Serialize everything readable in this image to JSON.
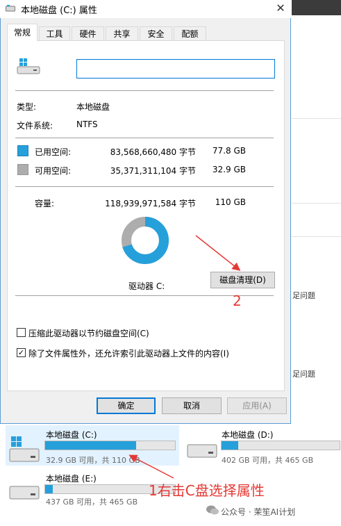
{
  "window": {
    "title": "本地磁盘 (C:) 属性",
    "close_glyph": "✕"
  },
  "tabs": [
    {
      "label": "常规",
      "active": true
    },
    {
      "label": "工具",
      "active": false
    },
    {
      "label": "硬件",
      "active": false
    },
    {
      "label": "共享",
      "active": false
    },
    {
      "label": "安全",
      "active": false
    },
    {
      "label": "配额",
      "active": false
    }
  ],
  "general": {
    "name_value": "",
    "type_label": "类型:",
    "type_value": "本地磁盘",
    "fs_label": "文件系统:",
    "fs_value": "NTFS",
    "used_label": "已用空间:",
    "used_bytes": "83,568,660,480 字节",
    "used_size": "77.8 GB",
    "free_label": "可用空间:",
    "free_bytes": "35,371,311,104 字节",
    "free_size": "32.9 GB",
    "capacity_label": "容量:",
    "capacity_bytes": "118,939,971,584 字节",
    "capacity_size": "110 GB",
    "drive_label": "驱动器 C:",
    "cleanup_button": "磁盘清理(D)",
    "used_fraction": 0.703,
    "compress_label": "压缩此驱动器以节约磁盘空间(C)",
    "compress_checked": false,
    "index_label": "除了文件属性外，还允许索引此驱动器上文件的内容(I)",
    "index_checked": true
  },
  "footer": {
    "ok": "确定",
    "cancel": "取消",
    "apply": "应用(A)"
  },
  "colors": {
    "used": "#26a0da",
    "free": "#adadad",
    "accent": "#0078d7",
    "annotation": "#e53935"
  },
  "background": {
    "snippet_1": "足问题",
    "snippet_2": "足问题"
  },
  "drives": [
    {
      "name": "本地磁盘 (C:)",
      "usage": "32.9 GB 可用，共 110 GB",
      "used_fraction": 0.7
    },
    {
      "name": "本地磁盘 (D:)",
      "usage": "402 GB 可用，共 465 GB",
      "used_fraction": 0.14
    },
    {
      "name": "本地磁盘 (E:)",
      "usage": "437 GB 可用，共 465 GB",
      "used_fraction": 0.06
    }
  ],
  "annotations": {
    "step2": "2",
    "step1": "1右击C盘选择属性"
  },
  "watermark": "公众号 · 茉笙AI计划",
  "icons": {
    "drive": "hard-drive-icon",
    "close": "close-icon",
    "wechat": "wechat-icon"
  }
}
